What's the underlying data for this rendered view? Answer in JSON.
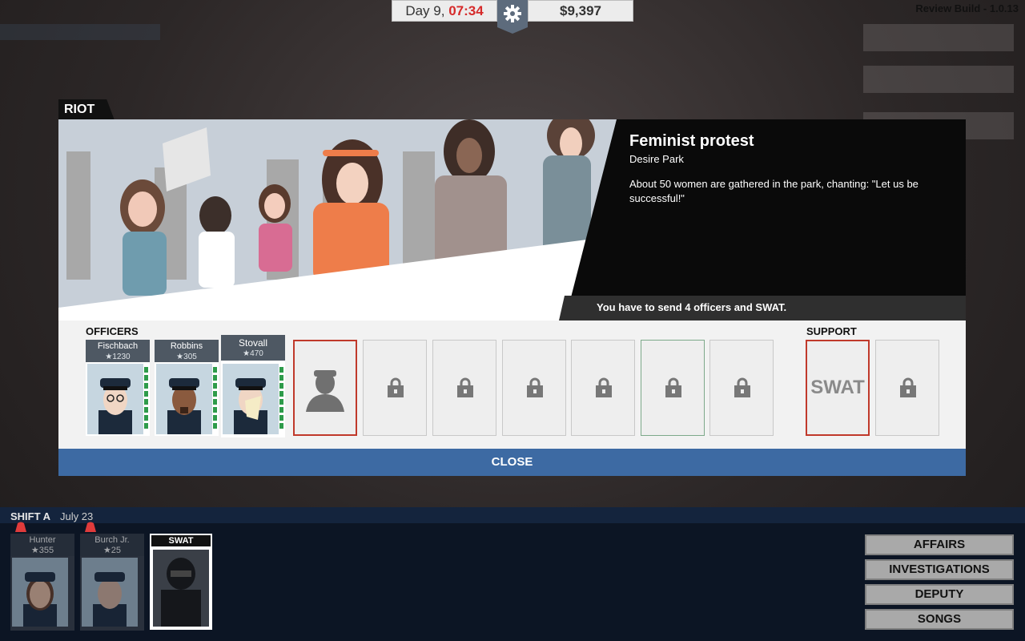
{
  "header": {
    "day_label": "Day 9,",
    "time": "07:34",
    "money": "$9,397",
    "build": "Review Build - 1.0.13"
  },
  "event": {
    "tab_label": "RIOT",
    "title": "Feminist protest",
    "location": "Desire Park",
    "description": "About 50 women are gathered in the park, chanting: \"Let us be successful!\"",
    "requirement": "You have to send 4 officers and SWAT."
  },
  "officers_section": {
    "label": "OFFICERS",
    "assigned": [
      {
        "name": "Fischbach",
        "rating": "★1230"
      },
      {
        "name": "Robbins",
        "rating": "★305"
      },
      {
        "name": "Stovall",
        "rating": "★470"
      }
    ]
  },
  "support_section": {
    "label": "SUPPORT",
    "swat_label": "SWAT"
  },
  "close_label": "CLOSE",
  "shift": {
    "label": "SHIFT A",
    "date": "July 23",
    "officers": [
      {
        "name": "Hunter",
        "rating": "★355"
      },
      {
        "name": "Burch Jr.",
        "rating": "★25"
      }
    ],
    "swat_label": "SWAT"
  },
  "menu": {
    "affairs": "AFFAIRS",
    "investigations": "INVESTIGATIONS",
    "deputy": "DEPUTY",
    "songs": "SONGS"
  },
  "colors": {
    "accent_blue": "#3d6aa3",
    "alert_red": "#c0392b",
    "time_red": "#d62a2a"
  }
}
